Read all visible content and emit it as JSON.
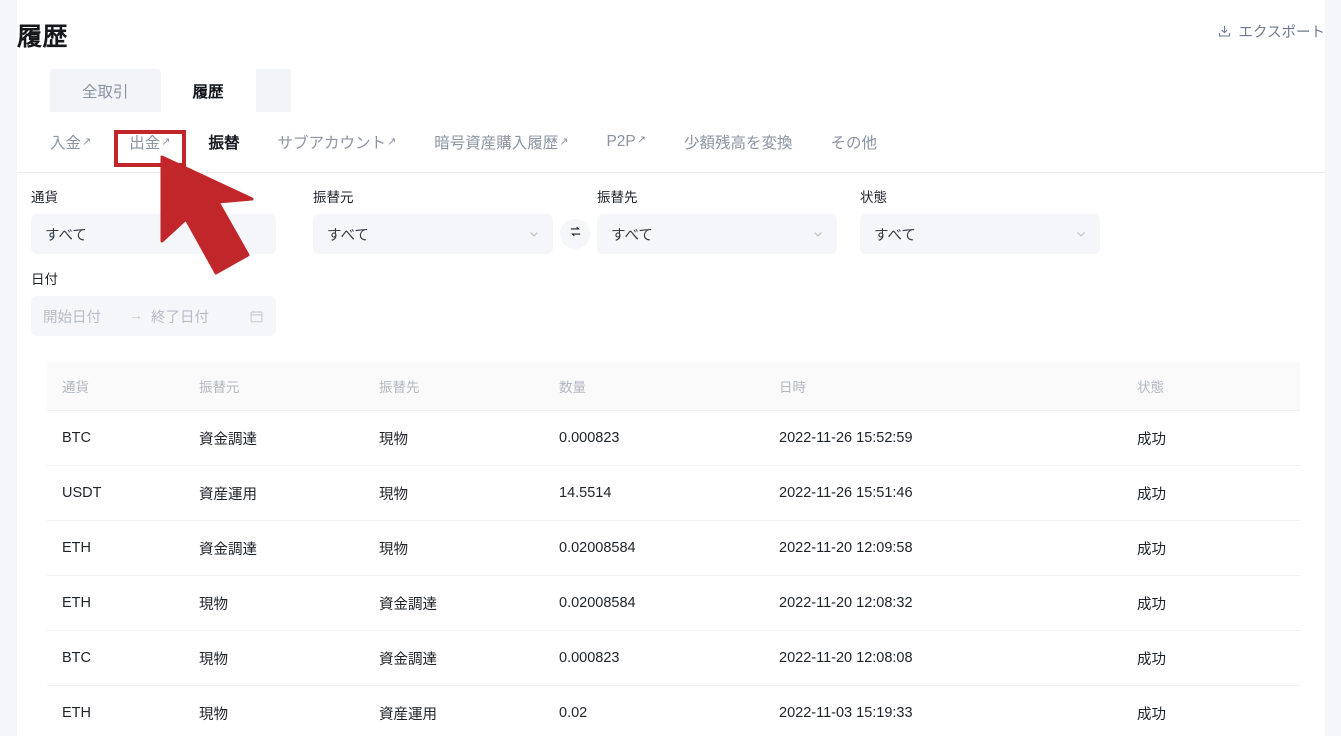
{
  "header": {
    "title": "履歴",
    "export_label": "エクスポート",
    "export_icon": "download-icon"
  },
  "tabs": [
    {
      "label": "全取引",
      "active": false
    },
    {
      "label": "履歴",
      "active": true
    }
  ],
  "subtabs": [
    {
      "label": "入金",
      "external": true,
      "active": false
    },
    {
      "label": "出金",
      "external": true,
      "active": false,
      "highlighted": true
    },
    {
      "label": "振替",
      "external": false,
      "active": true
    },
    {
      "label": "サブアカウント",
      "external": true,
      "active": false
    },
    {
      "label": "暗号資産購入履歴",
      "external": true,
      "active": false
    },
    {
      "label": "P2P",
      "external": true,
      "active": false
    },
    {
      "label": "少額残高を変換",
      "external": false,
      "active": false
    },
    {
      "label": "その他",
      "external": false,
      "active": false
    }
  ],
  "filters": {
    "currency": {
      "label": "通貨",
      "value": "すべて"
    },
    "from": {
      "label": "振替元",
      "value": "すべて",
      "caret": "chevron-down-icon"
    },
    "swap_icon": "swap-arrows-icon",
    "to": {
      "label": "振替先",
      "value": "すべて",
      "caret": "chevron-down-icon"
    },
    "status": {
      "label": "状態",
      "value": "すべて",
      "caret": "chevron-down-icon"
    },
    "date": {
      "label": "日付",
      "start_placeholder": "開始日付",
      "separator": "→",
      "end_placeholder": "終了日付",
      "calendar_icon": "calendar-icon"
    }
  },
  "table": {
    "columns": [
      "通貨",
      "振替元",
      "振替先",
      "数量",
      "日時",
      "状態"
    ],
    "rows": [
      {
        "currency": "BTC",
        "from": "資金調達",
        "to": "現物",
        "amount": "0.000823",
        "datetime": "2022-11-26 15:52:59",
        "status": "成功"
      },
      {
        "currency": "USDT",
        "from": "資産運用",
        "to": "現物",
        "amount": "14.5514",
        "datetime": "2022-11-26 15:51:46",
        "status": "成功"
      },
      {
        "currency": "ETH",
        "from": "資金調達",
        "to": "現物",
        "amount": "0.02008584",
        "datetime": "2022-11-20 12:09:58",
        "status": "成功"
      },
      {
        "currency": "ETH",
        "from": "現物",
        "to": "資金調達",
        "amount": "0.02008584",
        "datetime": "2022-11-20 12:08:32",
        "status": "成功"
      },
      {
        "currency": "BTC",
        "from": "現物",
        "to": "資金調達",
        "amount": "0.000823",
        "datetime": "2022-11-20 12:08:08",
        "status": "成功"
      },
      {
        "currency": "ETH",
        "from": "現物",
        "to": "資産運用",
        "amount": "0.02",
        "datetime": "2022-11-03 15:19:33",
        "status": "成功"
      }
    ]
  },
  "annotation": {
    "highlight_color": "#c0262a",
    "cursor_color": "#c0262a",
    "target": "出金"
  }
}
